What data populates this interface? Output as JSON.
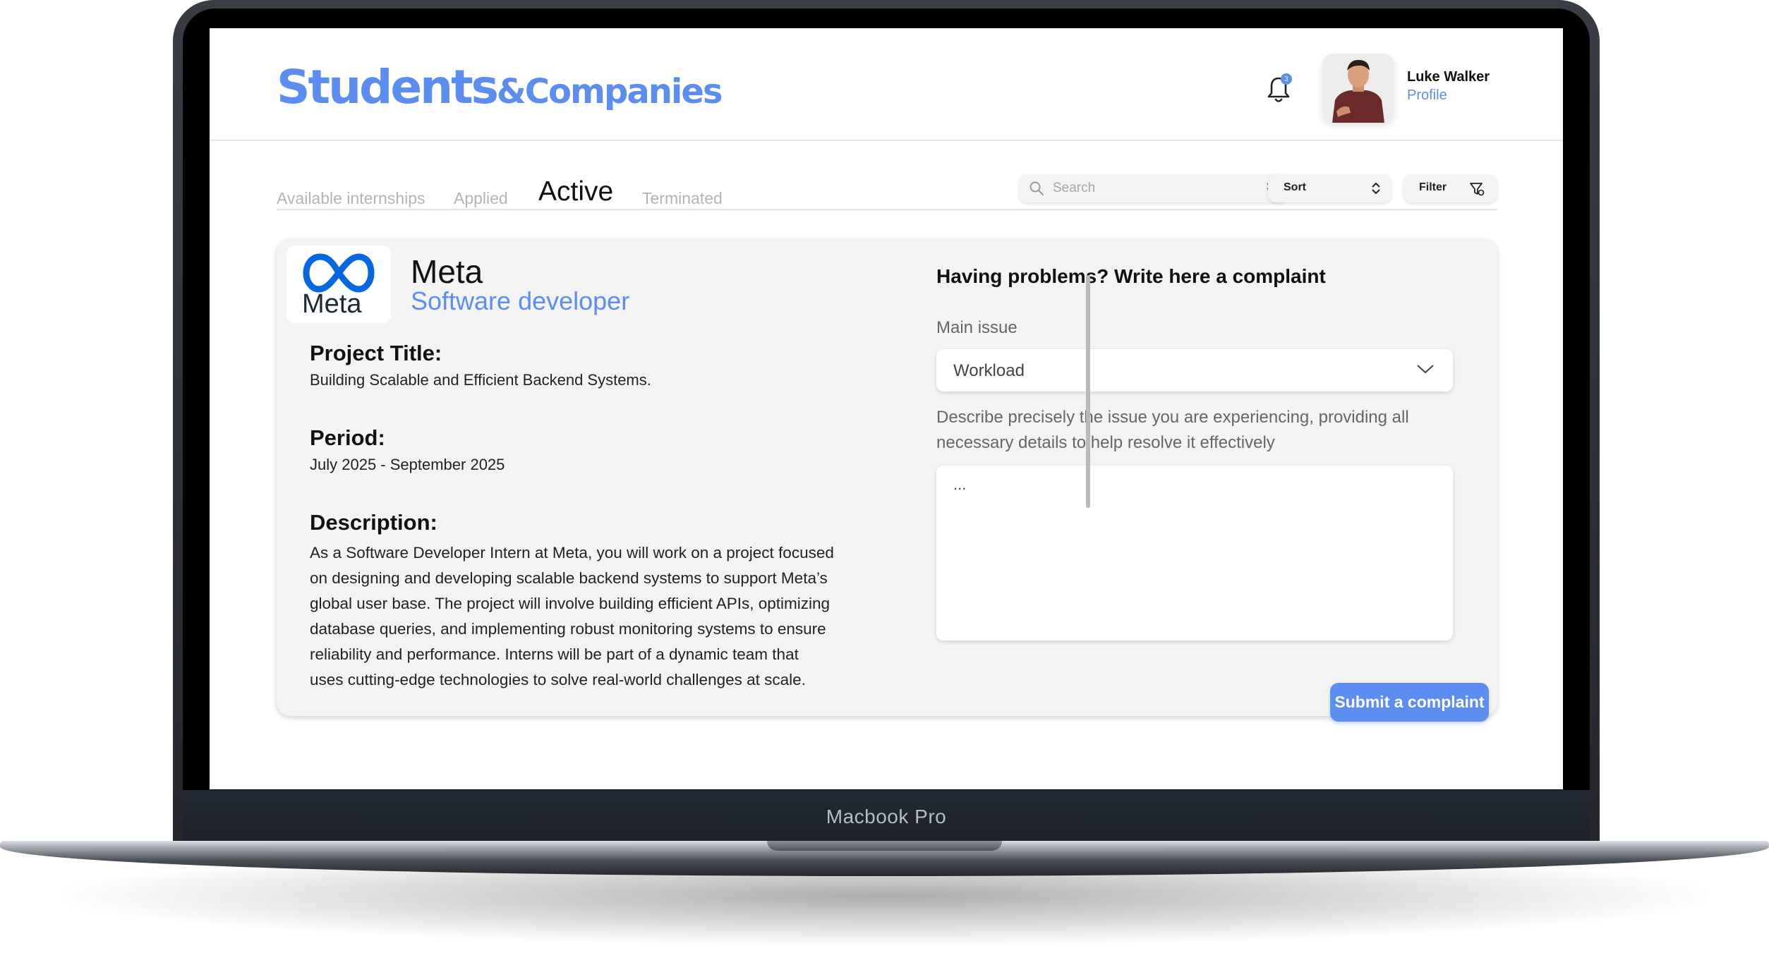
{
  "device": {
    "label": "Macbook Pro"
  },
  "header": {
    "brand_main": "Students",
    "brand_sub": "&Companies",
    "notification_count": "3",
    "user": {
      "name": "Luke Walker",
      "link": "Profile"
    }
  },
  "tabs": [
    {
      "label": "Available internships",
      "active": false
    },
    {
      "label": "Applied",
      "active": false
    },
    {
      "label": "Active",
      "active": true
    },
    {
      "label": "Terminated",
      "active": false
    }
  ],
  "toolbar": {
    "search_placeholder": "Search",
    "search_clear": "×",
    "sort_label": "Sort",
    "filter_label": "Filter"
  },
  "internship": {
    "logo_text": "Meta",
    "company": "Meta",
    "role": "Software developer",
    "project_title_label": "Project Title:",
    "project_title": "Building Scalable and Efficient Backend Systems.",
    "period_label": "Period:",
    "period": "July 2025 - September 2025",
    "description_label": "Description:",
    "description": "As a Software Developer Intern at Meta, you will work on a project focused on designing and developing scalable backend systems to support Meta’s global user base. The project will involve building efficient APIs, optimizing database queries, and implementing robust monitoring systems to ensure reliability and performance. Interns will be part of a dynamic team that uses cutting-edge technologies to solve real-world challenges at scale."
  },
  "complaint": {
    "title": "Having problems? Write here a complaint",
    "main_issue_label": "Main issue",
    "main_issue_value": "Workload",
    "details_help": "Describe precisely the issue you are experiencing, providing all necessary details to help resolve it effectively",
    "details_placeholder": "...",
    "submit_label": "Submit a complaint"
  },
  "colors": {
    "accent": "#5b8ef0",
    "card_bg": "#f3f3f3",
    "meta_blue": "#0668e1"
  }
}
